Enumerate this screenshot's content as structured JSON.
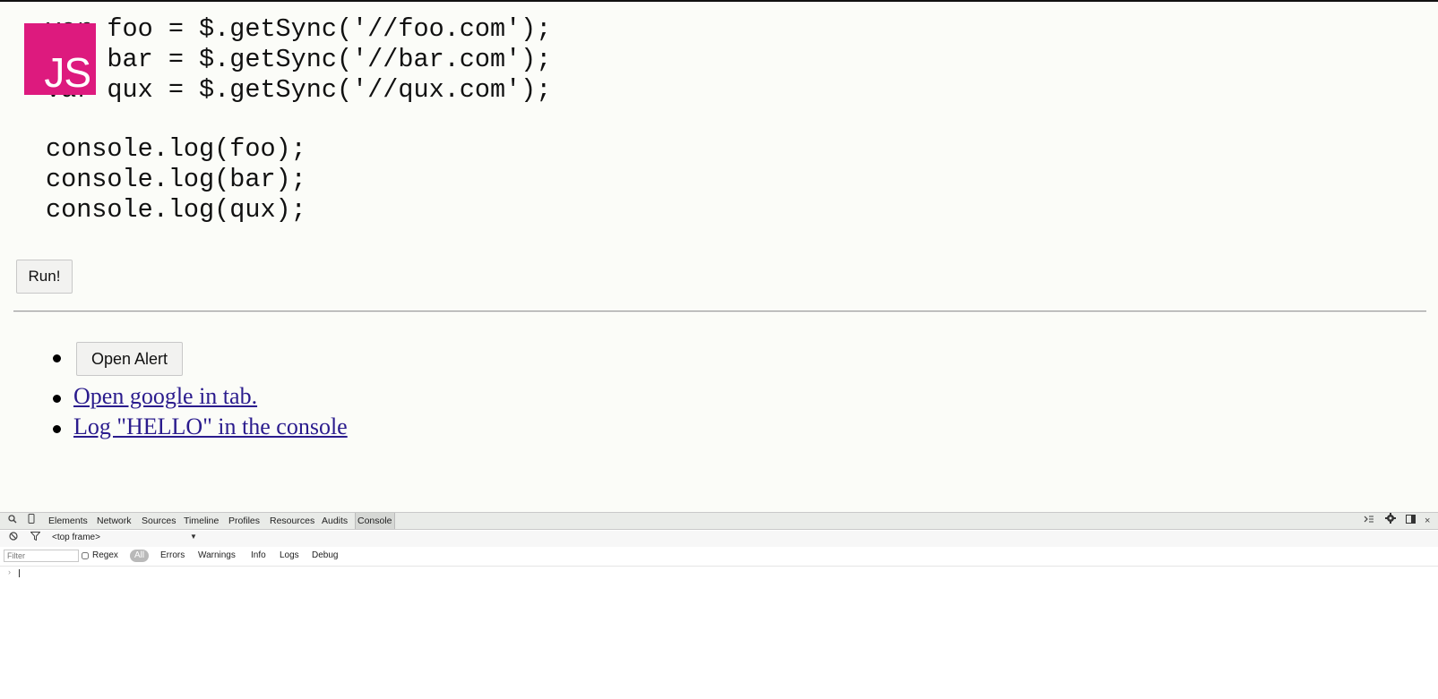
{
  "logo": {
    "text": "JS",
    "color": "#dd1a7e"
  },
  "code": {
    "lines": [
      "var foo = $.getSync('//foo.com');",
      "var bar = $.getSync('//bar.com');",
      "var qux = $.getSync('//qux.com');",
      "console.log(foo);",
      "console.log(bar);",
      "console.log(qux);"
    ]
  },
  "run_button": {
    "label": "Run!"
  },
  "links": {
    "open_alert": "Open Alert",
    "open_google": "Open google in tab.",
    "log_hello": "Log \"HELLO\" in the console"
  },
  "devtools": {
    "tabs": [
      "Elements",
      "Network",
      "Sources",
      "Timeline",
      "Profiles",
      "Resources",
      "Audits",
      "Console"
    ],
    "active_tab": "Console",
    "frame_selector": "<top frame>",
    "filter_placeholder": "Filter",
    "regex_label": "Regex",
    "levels": [
      "All",
      "Errors",
      "Warnings",
      "Info",
      "Logs",
      "Debug"
    ],
    "active_level": "All",
    "icons": {
      "inspect": "search-icon",
      "device": "device-icon",
      "clear": "clear-console-icon",
      "filter": "filter-icon",
      "drawer": "console-drawer-icon",
      "settings": "gear-icon",
      "dock": "dock-icon",
      "close": "close-icon"
    }
  }
}
